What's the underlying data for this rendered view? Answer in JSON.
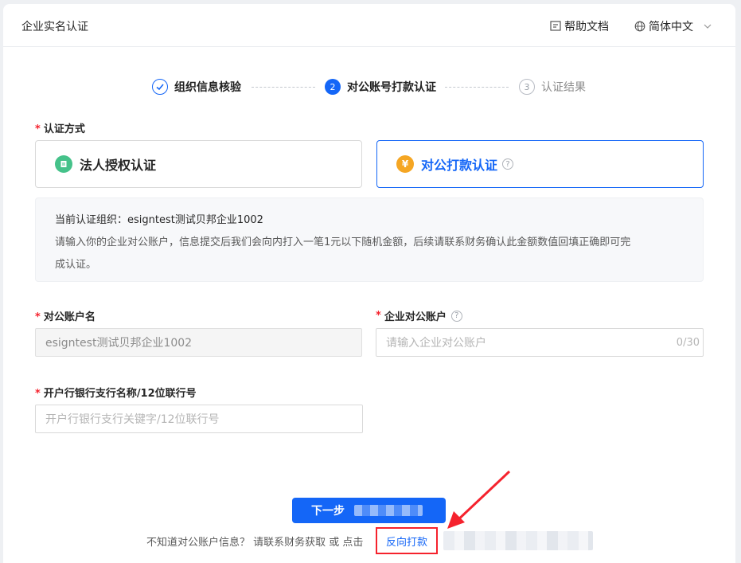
{
  "header": {
    "title": "企业实名认证",
    "help_label": "帮助文档",
    "language_label": "简体中文"
  },
  "steps": [
    {
      "label": "组织信息核验",
      "status": "done",
      "number": "1"
    },
    {
      "label": "对公账号打款认证",
      "status": "active",
      "number": "2"
    },
    {
      "label": "认证结果",
      "status": "todo",
      "number": "3"
    }
  ],
  "auth_method": {
    "label": "认证方式",
    "options": [
      {
        "label": "法人授权认证",
        "selected": false,
        "icon": "document-icon"
      },
      {
        "label": "对公打款认证",
        "selected": true,
        "icon": "yen-icon"
      }
    ]
  },
  "notice": {
    "org_line": "当前认证组织：esigntest测试贝邦企业1002",
    "description": "请输入你的企业对公账户，信息提交后我们会向内打入一笔1元以下随机金额，后续请联系财务确认此金额数值回填正确即可完",
    "description_tail": "成认证。"
  },
  "form": {
    "account_name": {
      "label": "对公账户名",
      "value": "esigntest测试贝邦企业1002"
    },
    "account_number": {
      "label": "企业对公账户",
      "placeholder": "请输入企业对公账户",
      "counter": "0/30"
    },
    "bank_branch": {
      "label": "开户行银行支行名称/12位联行号",
      "placeholder": "开户行银行支行关键字/12位联行号"
    }
  },
  "actions": {
    "next_label": "下一步",
    "help_text": "不知道对公账户信息？ 请联系财务获取 或 点击",
    "reverse_label": "反向打款"
  },
  "colors": {
    "primary": "#1466f7",
    "required": "#f5222d",
    "legal_icon": "#45c28a",
    "bank_icon": "#f5a623"
  }
}
